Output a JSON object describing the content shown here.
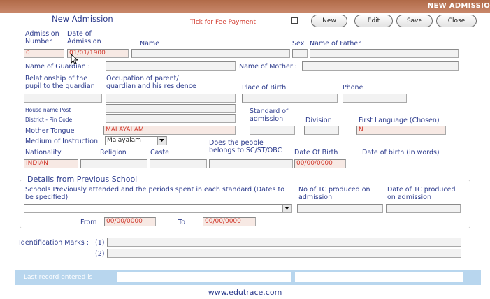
{
  "window": {
    "title": "NEW ADMISSIO"
  },
  "header": {
    "form_title": "New Admission",
    "fee_label": "Tick for Fee Payment"
  },
  "toolbar": {
    "new_label": "New",
    "edit_label": "Edit",
    "save_label": "Save",
    "close_label": "Close"
  },
  "labels": {
    "admission_number": "Admission Number",
    "date_of_admission": "Date of Admission",
    "name": "Name",
    "sex": "Sex",
    "name_of_father": "Name of Father",
    "name_of_guardian": "Name of Guardian :",
    "name_of_mother": "Name of Mother :",
    "relationship": "Relationship of the pupil to the guardian",
    "occupation": "Occupation of parent/ guardian and his residence",
    "place_of_birth": "Place of Birth",
    "phone": "Phone",
    "house_name": "House name,Post",
    "district_pin": "District - Pin Code",
    "standard": "Standard of admission",
    "division": "Division",
    "first_language": "First Language (Chosen)",
    "mother_tongue": "Mother Tongue",
    "medium": "Medium of Instruction",
    "sc_st": "Does the people belongs to SC/ST/OBC",
    "nationality": "Nationality",
    "religion": "Religion",
    "caste": "Caste",
    "date_of_birth": "Date Of Birth",
    "dob_words": "Date of birth (in words)",
    "schools_prev": "Schools Previously attended and the periods spent in each standard (Dates to be specified)",
    "tc_count": "No of TC produced on admission",
    "tc_date": "Date of TC produced on admission",
    "from": "From",
    "to": "To",
    "identification": "Identification Marks :",
    "mark1": "(1)",
    "mark2": "(2)"
  },
  "values": {
    "admission_number": "0",
    "date_of_admission": "01/01/1900",
    "mother_tongue": "MALAYALAM",
    "medium": "Malayalam",
    "first_language": "N",
    "nationality": "INDIAN",
    "date_of_birth": "00/00/0000",
    "from_date": "00/00/0000",
    "to_date": "00/00/0000"
  },
  "previous_school": {
    "legend": "Details from Previous School"
  },
  "status": {
    "last_record_label": "Last record entered is"
  },
  "footer": {
    "url": "www.edutrace.com"
  }
}
